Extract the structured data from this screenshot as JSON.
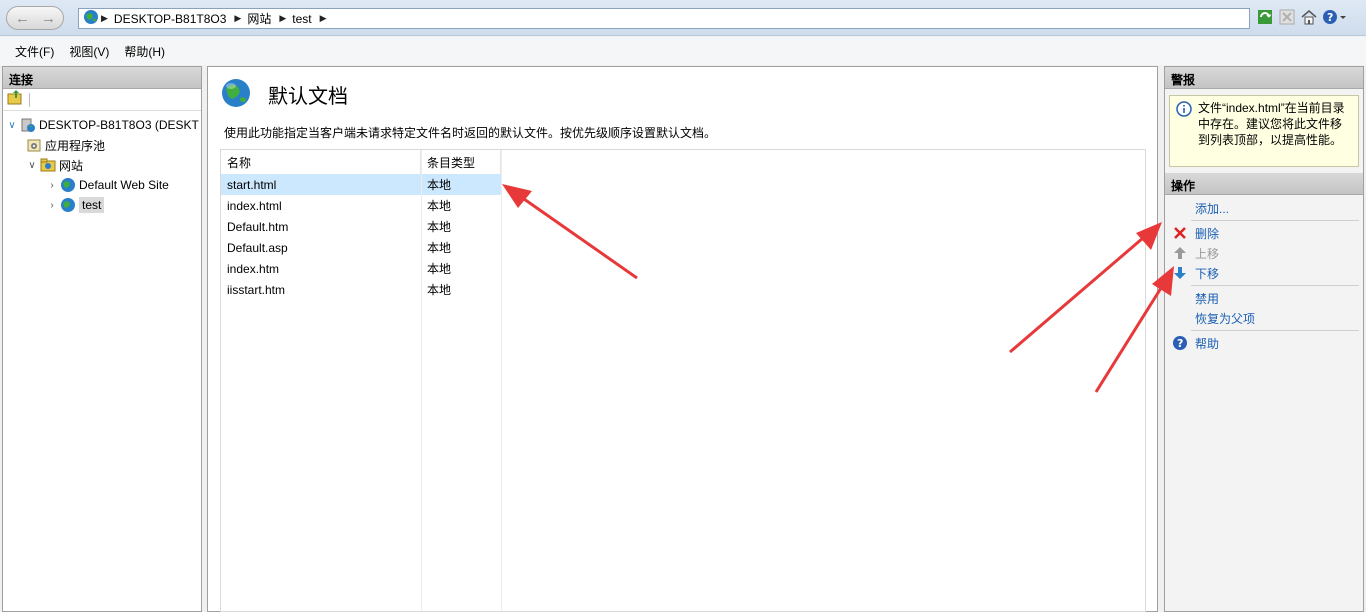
{
  "addressbar": {
    "crumbs": [
      "DESKTOP-B81T8O3",
      "网站",
      "test"
    ]
  },
  "menu": {
    "items": [
      "文件(F)",
      "视图(V)",
      "帮助(H)"
    ]
  },
  "connections": {
    "title": "连接",
    "tree": [
      {
        "label": "DESKTOP-B81T8O3 (DESKT",
        "icon": "server-icon",
        "expanded": true
      },
      {
        "label": "应用程序池",
        "icon": "app-pool-icon"
      },
      {
        "label": "网站",
        "icon": "sites-folder-icon",
        "expanded": true
      },
      {
        "label": "Default Web Site",
        "icon": "globe-icon"
      },
      {
        "label": "test",
        "icon": "globe-icon",
        "selected": true
      }
    ]
  },
  "main": {
    "title": "默认文档",
    "description": "使用此功能指定当客户端未请求特定文件名时返回的默认文件。按优先级顺序设置默认文档。",
    "columns": [
      "名称",
      "条目类型"
    ],
    "rows": [
      {
        "name": "start.html",
        "type": "本地",
        "selected": true
      },
      {
        "name": "index.html",
        "type": "本地"
      },
      {
        "name": "Default.htm",
        "type": "本地"
      },
      {
        "name": "Default.asp",
        "type": "本地"
      },
      {
        "name": "index.htm",
        "type": "本地"
      },
      {
        "name": "iisstart.htm",
        "type": "本地"
      }
    ]
  },
  "alerts": {
    "title": "警报",
    "message": "文件“index.html”在当前目录中存在。建议您将此文件移到列表顶部，以提高性能。"
  },
  "actions": {
    "title": "操作",
    "add": "添加...",
    "remove": "删除",
    "move_up": "上移",
    "move_down": "下移",
    "disable": "禁用",
    "revert": "恢复为父项",
    "help": "帮助"
  },
  "colors": {
    "link": "#1a5fb4",
    "selection": "#cce8ff",
    "annotation": "#e8393a"
  }
}
